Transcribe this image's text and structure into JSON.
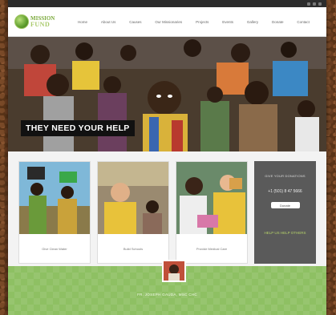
{
  "topbar": {
    "contact": "",
    "social_icons": [
      "facebook-icon",
      "twitter-icon",
      "youtube-icon"
    ]
  },
  "logo": {
    "line1": "MISSION",
    "line2": "FUND"
  },
  "nav": [
    "Home",
    "About Us",
    "Causes",
    "Our Missionaries",
    "Projects",
    "Events",
    "Gallery",
    "Donate",
    "Contact"
  ],
  "hero": {
    "banner": "THEY NEED YOUR HELP"
  },
  "cards": [
    {
      "caption": "Give Clean Water"
    },
    {
      "caption": "Build Schools"
    },
    {
      "caption": "Provide Medical Care"
    }
  ],
  "donate": {
    "title": "GIVE YOUR DONATIONS",
    "phone": "+1 (501) 8 47 5666",
    "button": "Donate",
    "link": "HELP US HELP OTHERS"
  },
  "footer": {
    "name": "FR. JOSEPH GAUDA, MSC CHC",
    "text": ""
  },
  "colors": {
    "accent_green": "#8ec063",
    "donate_bg": "#5a5a5a",
    "banner_bg": "#111111"
  }
}
